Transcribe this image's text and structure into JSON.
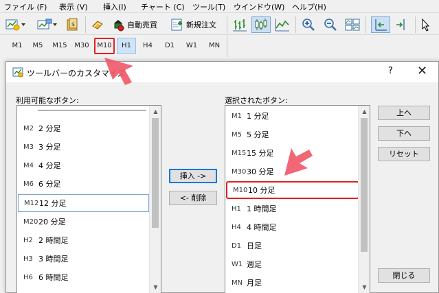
{
  "menu": [
    {
      "label": "ファイル (F)"
    },
    {
      "label": "表示 (V)"
    },
    {
      "label": "挿入(I)"
    },
    {
      "label": "チャート (C)"
    },
    {
      "label": "ツール(T)"
    },
    {
      "label": "ウインドウ(W)"
    },
    {
      "label": "ヘルプ(H)"
    }
  ],
  "toolbar": {
    "auto_trade_label": "自動売買",
    "new_order_label": "新規注文"
  },
  "periods": [
    "M1",
    "M5",
    "M15",
    "M30",
    "M10",
    "H1",
    "H4",
    "D1",
    "W1",
    "MN"
  ],
  "active_period": "H1",
  "highlighted_period": "M10",
  "dialog": {
    "title": "ツールバーのカスタマイズ",
    "help": "?",
    "close": "✕",
    "available_label": "利用可能なボタン:",
    "selected_label": "選択されたボタン:",
    "available_items": [
      {
        "code": "M2",
        "label": "2 分足"
      },
      {
        "code": "M3",
        "label": "3 分足"
      },
      {
        "code": "M4",
        "label": "4 分足"
      },
      {
        "code": "M6",
        "label": "6 分足"
      },
      {
        "code": "M12",
        "label": "12 分足"
      },
      {
        "code": "M20",
        "label": "20 分足"
      },
      {
        "code": "H2",
        "label": "2 時間足"
      },
      {
        "code": "H3",
        "label": "3 時間足"
      },
      {
        "code": "H6",
        "label": "6 時間足"
      }
    ],
    "selected_items": [
      {
        "code": "M1",
        "label": "1 分足"
      },
      {
        "code": "M5",
        "label": "5 分足"
      },
      {
        "code": "M15",
        "label": "15 分足"
      },
      {
        "code": "M30",
        "label": "30 分足"
      },
      {
        "code": "M10",
        "label": "10 分足"
      },
      {
        "code": "H1",
        "label": "1 時間足"
      },
      {
        "code": "H4",
        "label": "4 時間足"
      },
      {
        "code": "D1",
        "label": "日足"
      },
      {
        "code": "W1",
        "label": "週足"
      },
      {
        "code": "MN",
        "label": "月足"
      }
    ],
    "insert_button": "挿入 ->",
    "delete_button": "<- 削除",
    "up_button": "上へ",
    "down_button": "下へ",
    "reset_button": "リセット",
    "close_button": "閉じる"
  },
  "colors": {
    "highlight": "#e02020",
    "arrow": "#f05a6a",
    "selection_border": "#7aa6d6"
  }
}
